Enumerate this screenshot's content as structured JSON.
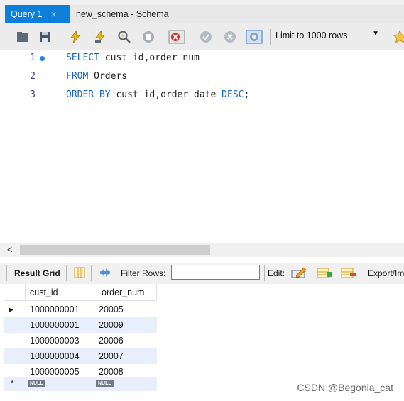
{
  "tabs": {
    "active_label": "Query 1",
    "close": "×",
    "inactive_label": "new_schema - Schema"
  },
  "toolbar": {
    "limit_label": "Limit to 1000 rows",
    "limit_arrow": "▼",
    "icons": [
      "open-folder-icon",
      "save-icon",
      "execute-icon",
      "execute-current-icon",
      "explain-icon",
      "stop-icon",
      "toggle-error-icon",
      "commit-icon",
      "rollback-icon",
      "autocommit-icon",
      "bookmark-star-icon"
    ]
  },
  "editor": {
    "lines": [
      {
        "num": "1",
        "kw": "SELECT",
        "rest": " cust_id,order_num"
      },
      {
        "num": "2",
        "kw": "FROM",
        "rest": " Orders"
      },
      {
        "num": "3",
        "kw": "ORDER BY",
        "rest": " cust_id,order_date ",
        "kw2": "DESC",
        "end": ";"
      }
    ]
  },
  "scroll": {
    "left_arrow": "<"
  },
  "result_bar": {
    "grid_label": "Result Grid",
    "filter_label": "Filter Rows:",
    "filter_value": "",
    "edit_label": "Edit:",
    "export_label": "Export/Im"
  },
  "grid": {
    "columns": [
      "cust_id",
      "order_num"
    ],
    "rows": [
      [
        "1000000001",
        "20005"
      ],
      [
        "1000000001",
        "20009"
      ],
      [
        "1000000003",
        "20006"
      ],
      [
        "1000000004",
        "20007"
      ],
      [
        "1000000005",
        "20008"
      ]
    ],
    "null_label": "NULL",
    "row_marker": "▶",
    "new_row_marker": "*"
  },
  "colors": {
    "accent": "#0e7fd8",
    "keyword": "#1565c0",
    "row_stripe": "#e8eefb"
  },
  "watermark": "CSDN @Begonia_cat"
}
